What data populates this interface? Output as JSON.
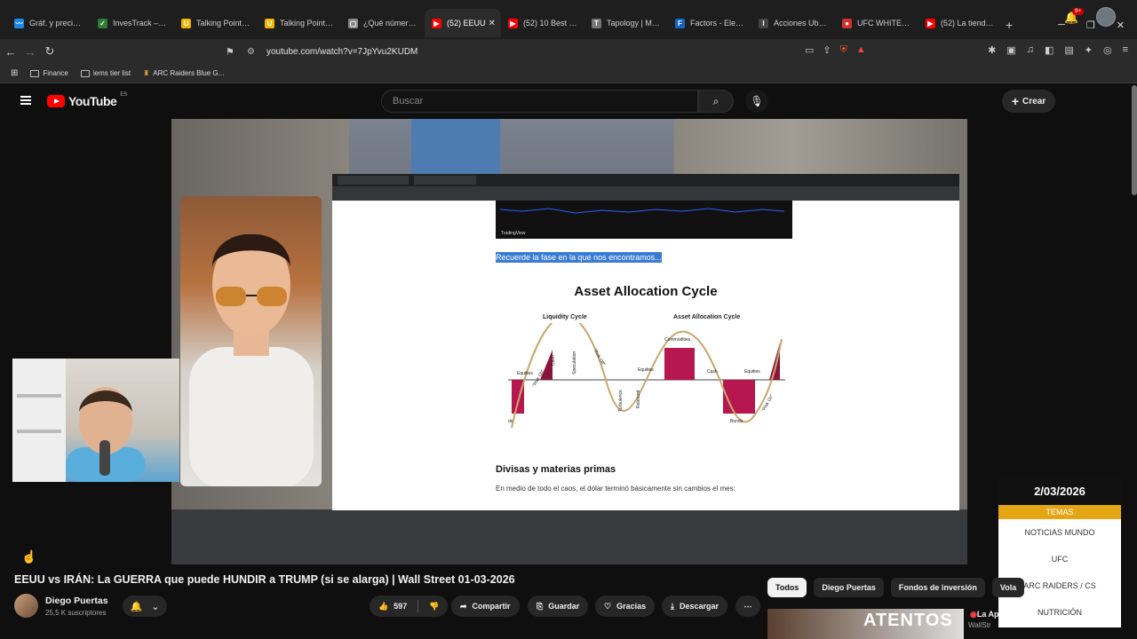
{
  "browser": {
    "tabs": [
      {
        "label": "Gráf. y precio fon",
        "color": "#1e88e5",
        "glyph": "〰"
      },
      {
        "label": "InvesTrack – Tus",
        "color": "#2e7d32",
        "glyph": "✓"
      },
      {
        "label": "Talking Points | M",
        "color": "#f0b400",
        "glyph": "U"
      },
      {
        "label": "Talking Points | M",
        "color": "#f0b400",
        "glyph": "U"
      },
      {
        "label": "¿Qué número de",
        "color": "#888888",
        "glyph": "▢"
      },
      {
        "label": "(52) EEUU",
        "color": "#ff0000",
        "glyph": "▶",
        "active": true
      },
      {
        "label": "(52) 10 Best NEW",
        "color": "#ff0000",
        "glyph": "▶"
      },
      {
        "label": "Tapology | MMA",
        "color": "#777777",
        "glyph": "T"
      },
      {
        "label": "Factors - Element",
        "color": "#1565c0",
        "glyph": "F"
      },
      {
        "label": "Acciones Ubisoft",
        "color": "#444444",
        "glyph": "I"
      },
      {
        "label": "UFC WHITE HOU",
        "color": "#d32f2f",
        "glyph": "●"
      },
      {
        "label": "(52) La tienda de",
        "color": "#ff0000",
        "glyph": "▶"
      }
    ],
    "url": "youtube.com/watch?v=7JpYvu2KUDM",
    "bookmarks": [
      "Finance",
      "iems tier list",
      "ARC Raiders Blue G..."
    ]
  },
  "youtube": {
    "logo_text": "YouTube",
    "region": "ES",
    "search_placeholder": "Buscar",
    "create_label": "Crear",
    "notif_badge": "9+"
  },
  "video_content": {
    "highlight_text": "Recuerde la fase en la que nos encontramos...",
    "tradingview": "TradingView",
    "cycle_title": "Asset Allocation Cycle",
    "liquidity_cycle": "Liquidity Cycle",
    "allocation_cycle": "Asset Allocation Cycle",
    "labels": {
      "equities_l": "Equities",
      "cash_l": "Cash",
      "speculation": "Speculation",
      "risk_off": "\"Risk Off\"",
      "risk_on_l": "\"Risk On\"",
      "turbulence": "Turbulence",
      "rebound": "Rebound",
      "equities_m": "Equities",
      "commodities": "Commodities",
      "cash_m": "Cash",
      "equities_r": "Equities",
      "bonds": "Bonds",
      "risk_on_r": "\"Risk On\"",
      "bonds_l": "ds"
    },
    "section_heading": "Divisas y materias primas",
    "section_text": "En medio de todo el caos, el dólar terminó básicamente sin cambios el mes:"
  },
  "overlay_panel": {
    "date": "2/03/2026",
    "header": "TEMAS",
    "items": [
      "NOTICIAS MUNDO",
      "UFC",
      "ARC RAIDERS / CS",
      "NUTRICIÓN"
    ]
  },
  "video": {
    "title": "EEUU vs IRÁN: La GUERRA que puede HUNDIR a TRUMP (si se alarga) | Wall Street 01-03-2026",
    "channel": "Diego Puertas",
    "subscribers": "25,5 K suscriptores",
    "likes": "597",
    "share_label": "Compartir",
    "save_label": "Guardar",
    "thanks_label": "Gracias",
    "download_label": "Descargar"
  },
  "chips": [
    "Todos",
    "Diego Puertas",
    "Fondos de inversión",
    "Vola"
  ],
  "related": {
    "thumb_text": "ATENTOS",
    "title": "La Ap",
    "channel": "WallStr"
  }
}
